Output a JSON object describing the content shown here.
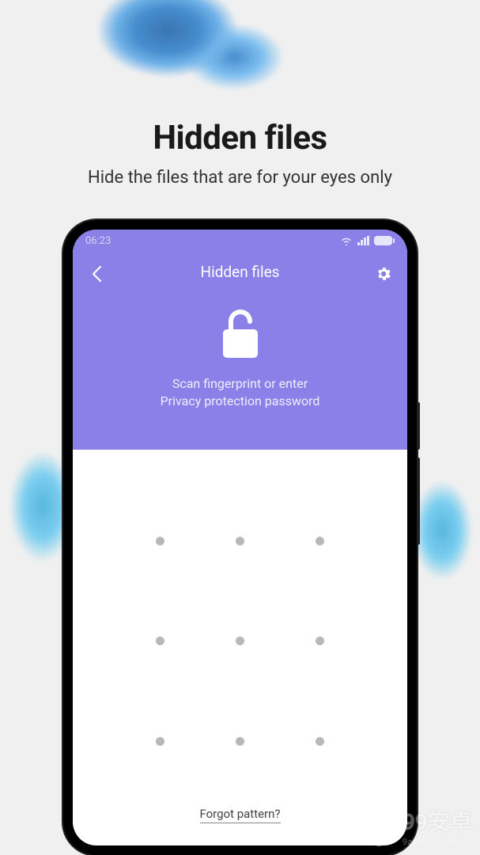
{
  "promo": {
    "title": "Hidden files",
    "subtitle": "Hide the files that are for your eyes only"
  },
  "statusbar": {
    "time": "06:23"
  },
  "header": {
    "title": "Hidden files",
    "message_line1": "Scan fingerprint or enter",
    "message_line2": "Privacy protection password"
  },
  "footer": {
    "forgot_label": "Forgot pattern?"
  },
  "watermark": {
    "main": "99安卓",
    "sub": "9anzhuo.com"
  }
}
